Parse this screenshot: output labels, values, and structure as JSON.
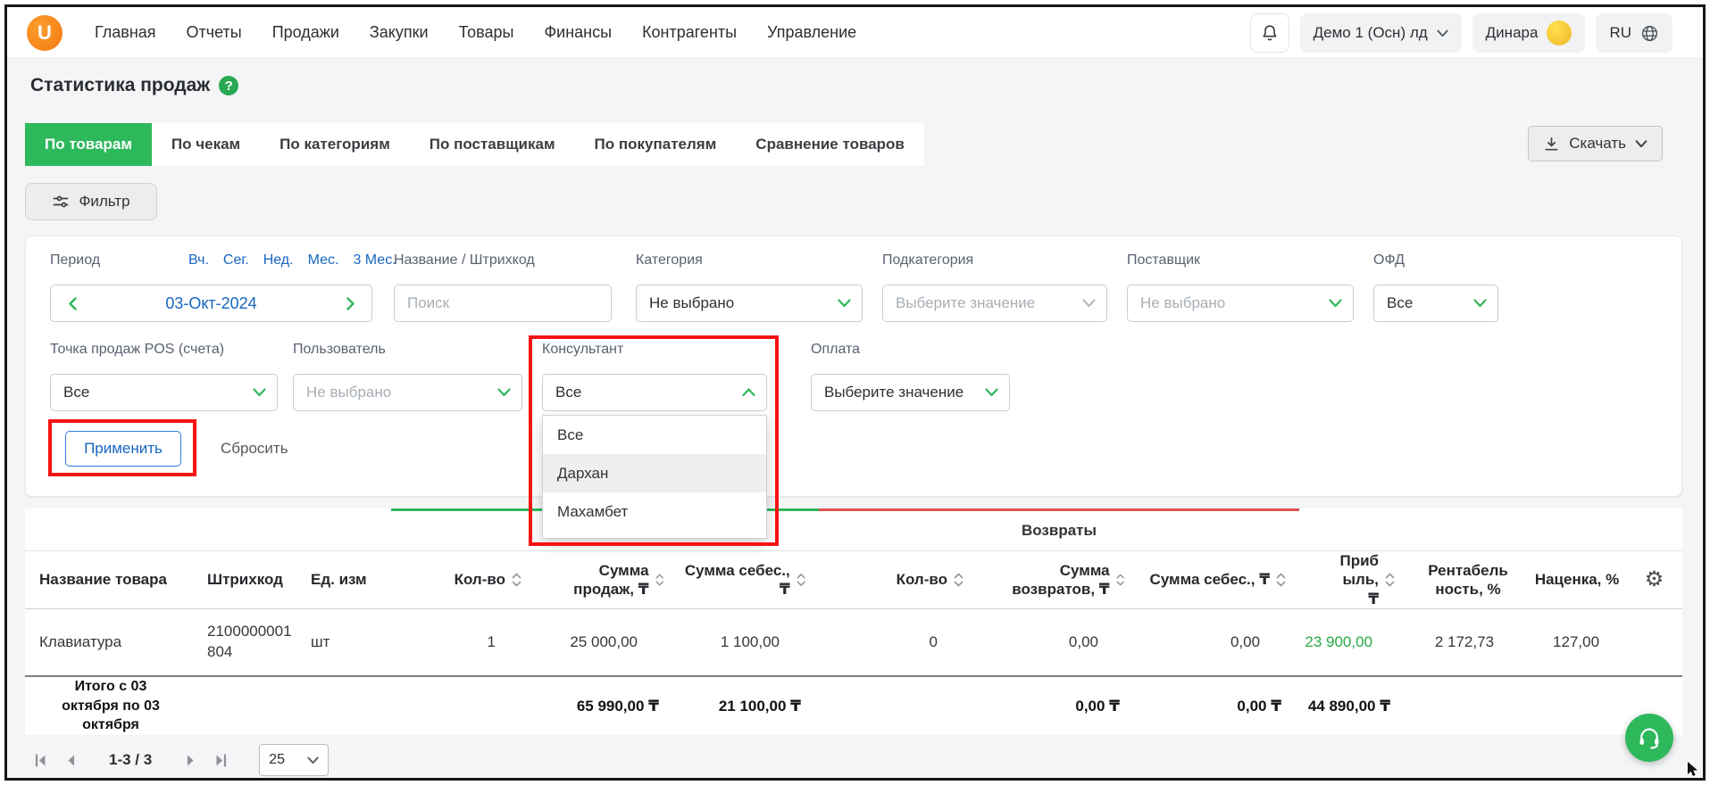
{
  "navbar": {
    "logo_letter": "U",
    "items": [
      "Главная",
      "Отчеты",
      "Продажи",
      "Закупки",
      "Товары",
      "Финансы",
      "Контрагенты",
      "Управление"
    ],
    "company": "Демо 1 (Осн) лд",
    "user": "Динара",
    "language": "RU"
  },
  "page": {
    "title": "Статистика продаж",
    "help": "?"
  },
  "tabs": [
    "По товарам",
    "По чекам",
    "По категориям",
    "По поставщикам",
    "По покупателям",
    "Сравнение товаров"
  ],
  "toolbar": {
    "download": "Скачать",
    "filter": "Фильтр"
  },
  "filters": {
    "period": {
      "label": "Период",
      "quick": [
        "Вч.",
        "Сег.",
        "Нед.",
        "Мес.",
        "3 Мес."
      ],
      "date": "03-Окт-2024"
    },
    "search": {
      "label": "Название / Штрихкод",
      "placeholder": "Поиск"
    },
    "category": {
      "label": "Категория",
      "value": "Не выбрано"
    },
    "subcategory": {
      "label": "Подкатегория",
      "value": "Выберите значение"
    },
    "supplier": {
      "label": "Поставщик",
      "value": "Не выбрано"
    },
    "ofd": {
      "label": "ОФД",
      "value": "Все"
    },
    "pos": {
      "label": "Точка продаж POS (счета)",
      "value": "Все"
    },
    "user": {
      "label": "Пользователь",
      "value": "Не выбрано"
    },
    "consultant": {
      "label": "Консультант",
      "value": "Все",
      "options": [
        "Все",
        "Дархан",
        "Махамбет"
      ],
      "highlighted": "Дархан"
    },
    "payment": {
      "label": "Оплата",
      "value": "Выберите значение"
    },
    "apply": "Применить",
    "reset": "Сбросить"
  },
  "table": {
    "group_returns": "Возвраты",
    "headers": {
      "name": "Название товара",
      "barcode": "Штрихкод",
      "unit": "Ед. изм",
      "qty": "Кол-во",
      "sales_sum": "Сумма продаж, ₸",
      "cost_sum": "Сумма себес., ₸",
      "ret_qty": "Кол-во",
      "ret_sum": "Сумма возвратов, ₸",
      "ret_cost": "Сумма себес., ₸",
      "profit": "Прибыль, ₸",
      "profitability": "Рентабельность, %",
      "markup": "Наценка, %"
    },
    "rows": [
      {
        "name": "Клавиатура",
        "barcode": "2100000001804",
        "unit": "шт",
        "qty": "1",
        "sales_sum": "25 000,00",
        "cost_sum": "1 100,00",
        "ret_qty": "0",
        "ret_sum": "0,00",
        "ret_cost": "0,00",
        "profit": "23 900,00",
        "profitability": "2 172,73",
        "markup": "127,00"
      }
    ],
    "footer": {
      "label": "Итого с 03 октября по 03 октября",
      "sales_sum": "65 990,00 ₸",
      "cost_sum": "21 100,00 ₸",
      "ret_sum": "0,00 ₸",
      "ret_cost": "0,00 ₸",
      "profit": "44 890,00 ₸"
    }
  },
  "pagination": {
    "range": "1-3 / 3",
    "page_size": "25"
  }
}
